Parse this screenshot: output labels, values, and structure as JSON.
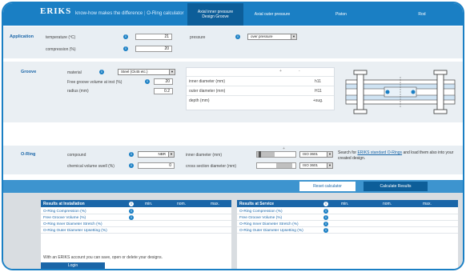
{
  "header": {
    "logo": "ERIKS",
    "tagline": "know-how makes the difference",
    "separator": "|",
    "app_name": "O-Ring calculator",
    "tabs": [
      {
        "line1": "Axial inner pressure",
        "line2": "Design Groove",
        "active": true
      },
      {
        "line1": "Axial outer pressure",
        "line2": "",
        "active": false
      },
      {
        "line1": "Piston",
        "line2": "",
        "active": false
      },
      {
        "line1": "Rod",
        "line2": "",
        "active": false
      }
    ]
  },
  "application": {
    "title": "Application",
    "temperature_label": "temperature (ºC)",
    "temperature_value": "21",
    "compression_label": "compression (%)",
    "compression_value": "20",
    "pressure_label": "pressure",
    "pressure_value": "over pressure"
  },
  "groove": {
    "title": "Groove",
    "material_label": "material",
    "material_value": "Steel (Ck45 etc.)",
    "free_volume_label": "Free groove volume at inst (%)",
    "free_volume_value": "20",
    "radius_label": "radius (mm)",
    "radius_value": "0.2",
    "table_header_plus": "+",
    "table_header_minus": "-",
    "rows": [
      {
        "label": "inner diameter (mm)",
        "tolerance": "h11"
      },
      {
        "label": "outer diameter (mm)",
        "tolerance": "H11"
      },
      {
        "label": "depth (mm)",
        "tolerance": "+sug."
      }
    ]
  },
  "oring": {
    "title": "O-Ring",
    "compound_label": "compound",
    "compound_value": "NBR",
    "swell_label": "chemical volume swell (%)",
    "swell_value": "0",
    "inner_diameter_label": "inner diameter (mm)",
    "inner_diameter_std": "ISO 3601",
    "cross_section_label": "cross section diameter (mm)",
    "cross_section_std": "ISO 3601",
    "slider_plus": "+",
    "search_text_1": "Search for",
    "search_link": "ERIKS standard O-Rings",
    "search_text_2": "and load them also into your created design."
  },
  "actions": {
    "reset_label": "Reset calculator",
    "calculate_label": "Calculate Results"
  },
  "results_installation": {
    "title": "Results at Installation",
    "col_min": "min.",
    "col_nom": "nom.",
    "col_max": "max.",
    "rows": [
      "O-Ring Compression (%)",
      "Free Groove Volume (%)",
      "O-Ring Inner Diameter Stretch (%)",
      "O-Ring Outer Diameter Upsetting (%)"
    ],
    "account_text": "With an ERIKS account you can save, open or delete your designs.",
    "login_label": "Login"
  },
  "results_service": {
    "title": "Results at Service",
    "col_min": "min.",
    "col_nom": "nom.",
    "col_max": "max.",
    "rows": [
      "O-Ring Compression (%)",
      "Free Groove Volume (%)",
      "O-Ring Inner Diameter Stretch (%)",
      "O-Ring Outer Diameter Upsetting (%)"
    ]
  },
  "colors": {
    "brand_blue": "#1a7fc4",
    "dark_blue": "#0d5e99",
    "bar_blue": "#3d94cf"
  }
}
